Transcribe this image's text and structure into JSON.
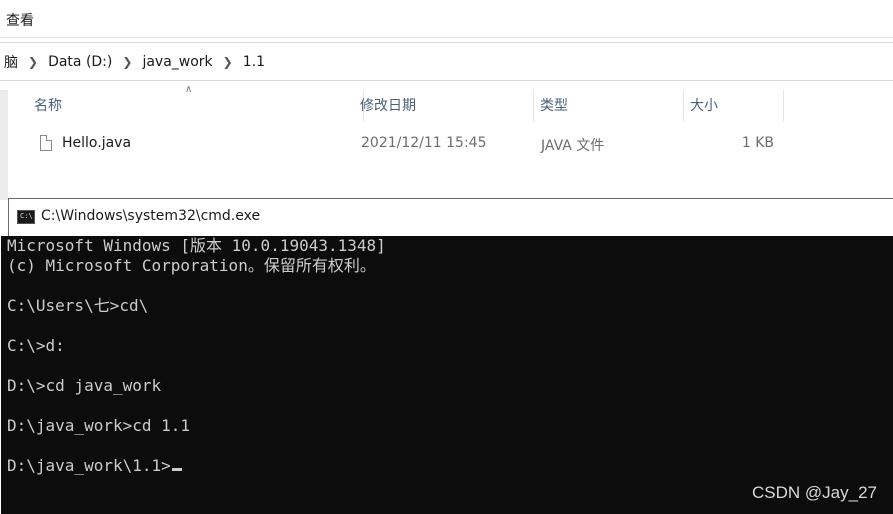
{
  "explorer": {
    "ribbon_tab": "查看",
    "breadcrumb": [
      "脑",
      "Data (D:)",
      "java_work",
      "1.1"
    ],
    "columns": {
      "name": "名称",
      "date": "修改日期",
      "type": "类型",
      "size": "大小"
    },
    "files": [
      {
        "name": "Hello.java",
        "date": "2021/12/11 15:45",
        "type": "JAVA 文件",
        "size": "1 KB",
        "icon": "file-icon"
      }
    ]
  },
  "cmd": {
    "title": "C:\\Windows\\system32\\cmd.exe",
    "icon_label": "C:\\",
    "lines": [
      "Microsoft Windows [版本 10.0.19043.1348]",
      "(c) Microsoft Corporation。保留所有权利。",
      "",
      "C:\\Users\\七>cd\\",
      "",
      "C:\\>d:",
      "",
      "D:\\>cd java_work",
      "",
      "D:\\java_work>cd 1.1",
      "",
      "D:\\java_work\\1.1>"
    ],
    "colors": {
      "background": "#0c0c0c",
      "text": "#cccccc"
    }
  },
  "watermark": "CSDN @Jay_27"
}
